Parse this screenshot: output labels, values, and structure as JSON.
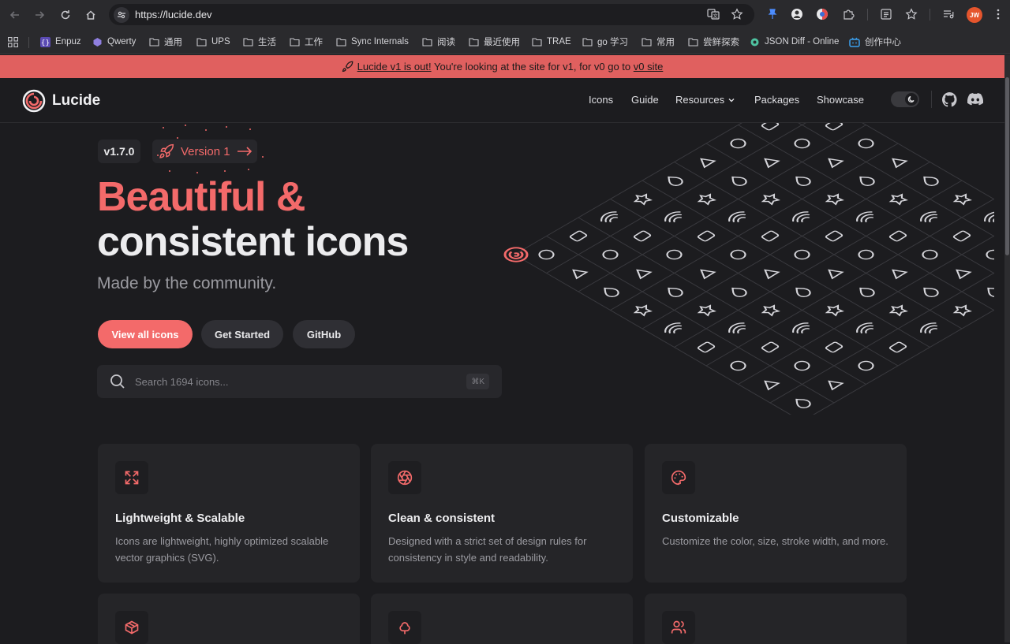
{
  "browser": {
    "url": "https://lucide.dev",
    "avatar_initials": "JW"
  },
  "bookmarks": [
    {
      "label": "Enpuz",
      "icon": "code-braces-icon"
    },
    {
      "label": "Qwerty",
      "icon": "cube-icon"
    },
    {
      "label": "通用",
      "icon": "folder-icon"
    },
    {
      "label": "UPS",
      "icon": "folder-icon"
    },
    {
      "label": "生活",
      "icon": "folder-icon"
    },
    {
      "label": "工作",
      "icon": "folder-icon"
    },
    {
      "label": "Sync Internals",
      "icon": "folder-icon"
    },
    {
      "label": "阅读",
      "icon": "folder-icon"
    },
    {
      "label": "最近使用",
      "icon": "folder-icon"
    },
    {
      "label": "TRAE",
      "icon": "folder-icon"
    },
    {
      "label": "go 学习",
      "icon": "folder-icon"
    },
    {
      "label": "常用",
      "icon": "folder-icon"
    },
    {
      "label": "尝鲜探索",
      "icon": "folder-icon"
    },
    {
      "label": "JSON Diff - Online",
      "icon": "gear-icon"
    },
    {
      "label": "创作中心",
      "icon": "tv-icon"
    }
  ],
  "banner": {
    "link1": "Lucide v1 is out!",
    "middle": " You're looking at the site for v1, for v0 go to ",
    "link2": "v0 site"
  },
  "header": {
    "logo": "Lucide",
    "nav": [
      "Icons",
      "Guide",
      "Resources",
      "Packages",
      "Showcase"
    ]
  },
  "hero": {
    "version_badge": "v1.7.0",
    "version_link": "Version 1",
    "title_line1": "Beautiful &",
    "title_line2": "consistent icons",
    "subtitle": "Made by the community.",
    "buttons": [
      "View all icons",
      "Get Started",
      "GitHub"
    ],
    "search_placeholder": "Search 1694 icons...",
    "search_shortcut": "⌘K"
  },
  "features": [
    {
      "title": "Lightweight & Scalable",
      "desc": "Icons are lightweight, highly optimized scalable vector graphics (SVG).",
      "icon": "maximize-icon"
    },
    {
      "title": "Clean & consistent",
      "desc": "Designed with a strict set of design rules for consistency in style and readability.",
      "icon": "aperture-icon"
    },
    {
      "title": "Customizable",
      "desc": "Customize the color, size, stroke width, and more.",
      "icon": "palette-icon"
    }
  ],
  "features_row2_icons": [
    "package-icon",
    "tree-icon",
    "users-icon"
  ],
  "colors": {
    "accent": "#f36a6a",
    "banner": "#e0605f",
    "background": "#1c1c1f",
    "card": "#252528"
  }
}
